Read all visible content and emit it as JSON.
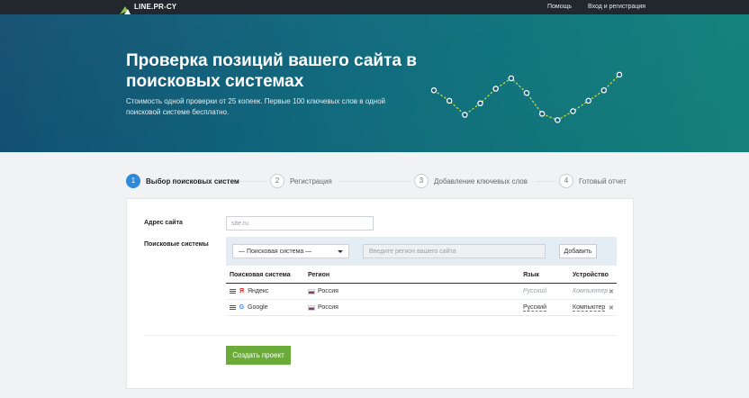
{
  "nav": {
    "logo_text": "LINE.PR-CY",
    "help_label": "Помощь",
    "login_label": "Вход и регистрация"
  },
  "hero": {
    "title": "Проверка позиций вашего сайта в поисковых системах",
    "subtitle": "Стоимость одной проверки от 25 копеек. Первые 100 ключевых слов в одной поисковой системе бесплатно.",
    "chart_values": [
      0.35,
      0.55,
      0.82,
      0.6,
      0.32,
      0.12,
      0.4,
      0.8,
      0.92,
      0.75,
      0.55,
      0.35,
      0.05
    ]
  },
  "steps": [
    {
      "num": "1",
      "label": "Выбор поисковых систем",
      "active": true
    },
    {
      "num": "2",
      "label": "Регистрация",
      "active": false
    },
    {
      "num": "3",
      "label": "Добавление ключевых слов",
      "active": false
    },
    {
      "num": "4",
      "label": "Готовый отчет",
      "active": false
    }
  ],
  "form": {
    "site_label": "Адрес сайта",
    "site_placeholder": "site.ru",
    "engines_label": "Поисковые системы",
    "engine_select": "— Поисковая система —",
    "region_placeholder": "Введите регион вашего сайта",
    "add_label": "Добавить",
    "table": {
      "headers": {
        "engine": "Поисковая система",
        "region": "Регион",
        "lang": "Язык",
        "device": "Устройство"
      },
      "rows": [
        {
          "icon": "Я",
          "engine": "Яндекс",
          "region": "Россия",
          "lang": "Русский",
          "device": "Компьютер",
          "editable": false
        },
        {
          "icon": "G",
          "engine": "Google",
          "region": "Россия",
          "lang": "Русский",
          "device": "Компьютер",
          "editable": true
        }
      ]
    },
    "create_label": "Создать проект"
  },
  "colors": {
    "accent": "#2e8ad8",
    "button_green": "#6aab3a",
    "nav_bg": "#22272d",
    "chart_line": "#c8e04a"
  }
}
